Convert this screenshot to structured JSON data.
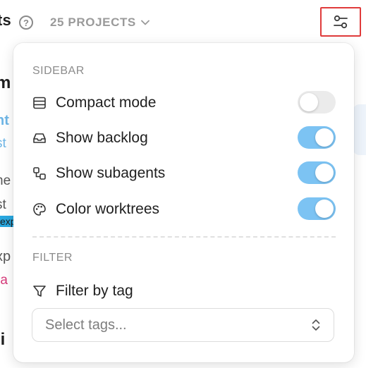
{
  "topbar": {
    "title_fragment": "ts",
    "help_glyph": "?",
    "projects_label": "25 PROJECTS"
  },
  "background": {
    "peek_1": "m",
    "peek_2": "nt",
    "peek_3": "st",
    "peek_4": "ne",
    "peek_5": "st",
    "peek_6": "exp",
    "peek_7": "xp",
    "peek_8": "ra",
    "peek_9": "li"
  },
  "panel": {
    "sidebar_section": "SIDEBAR",
    "options": [
      {
        "label": "Compact mode",
        "icon": "rows-icon",
        "enabled": false
      },
      {
        "label": "Show backlog",
        "icon": "inbox-icon",
        "enabled": true
      },
      {
        "label": "Show subagents",
        "icon": "subagents-icon",
        "enabled": true
      },
      {
        "label": "Color worktrees",
        "icon": "palette-icon",
        "enabled": true
      }
    ],
    "filter_section": "FILTER",
    "filter_label": "Filter by tag",
    "select_placeholder": "Select tags..."
  },
  "colors": {
    "toggle_on": "#7cc3f3",
    "toggle_off": "#ebebeb",
    "highlight_border": "#e03b3b",
    "peek_blue": "#6fb6e6",
    "peek_pink": "#d63a7a",
    "tag_badge": "#29a8e0"
  }
}
